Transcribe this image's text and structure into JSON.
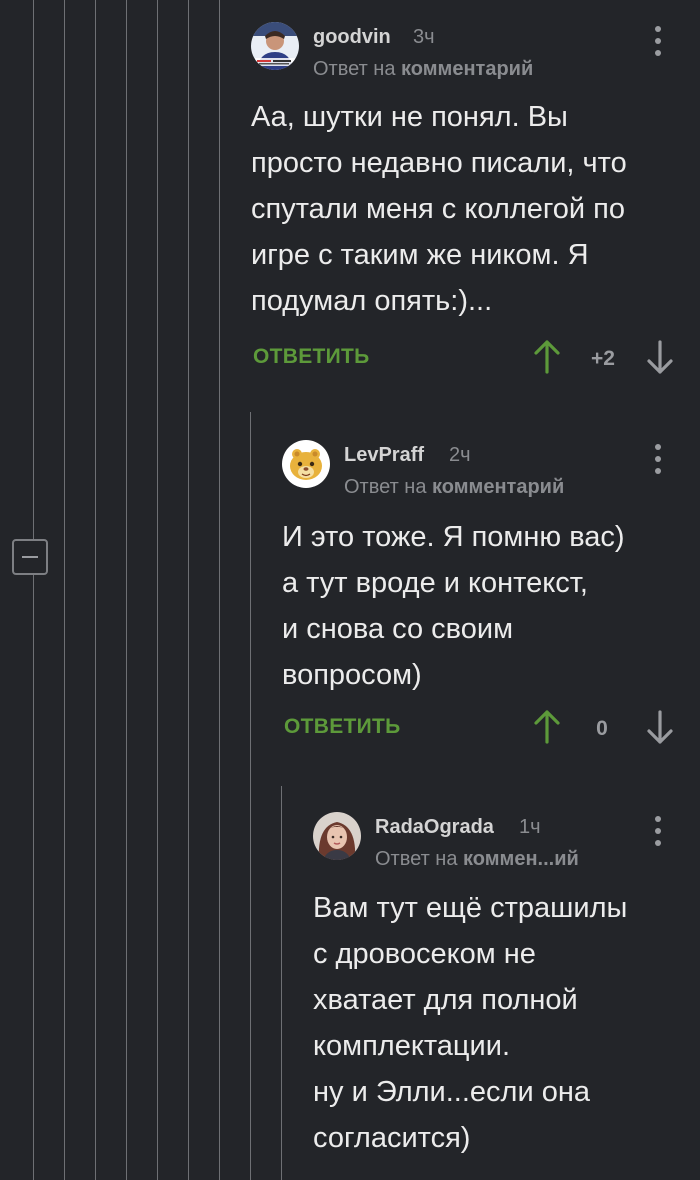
{
  "thread": {
    "collapse_icon": "minus-square-icon"
  },
  "comments": [
    {
      "author": "goodvin",
      "time": "3ч",
      "reply_prefix": "Ответ на",
      "reply_link": "комментарий",
      "text": "Аа, шутки не понял. Вы\nпросто недавно писали, что\nспутали меня с коллегой по\nигре с таким же ником. Я\nподумал опять:)...",
      "reply_label": "ОТВЕТИТЬ",
      "rating": "+2"
    },
    {
      "author": "LevPraff",
      "time": "2ч",
      "reply_prefix": "Ответ на",
      "reply_link": "комментарий",
      "text": "И это тоже. Я помню вас)\nа тут вроде и контекст,\nи снова со своим\nвопросом)",
      "reply_label": "ОТВЕТИТЬ",
      "rating": "0"
    },
    {
      "author": "RadaOgrada",
      "time": "1ч",
      "reply_prefix": "Ответ на",
      "reply_link": "коммен...ий",
      "text": "Вам тут ещё страшилы\nс дровосеком не\nхватает для полной\nкомплектации.\nну и Элли...если она\nсогласится)"
    }
  ],
  "colors": {
    "background": "#232529",
    "reply_green": "#5d9a3a",
    "vote_up_green": "#5d9a3a",
    "muted": "#8a8c90"
  }
}
